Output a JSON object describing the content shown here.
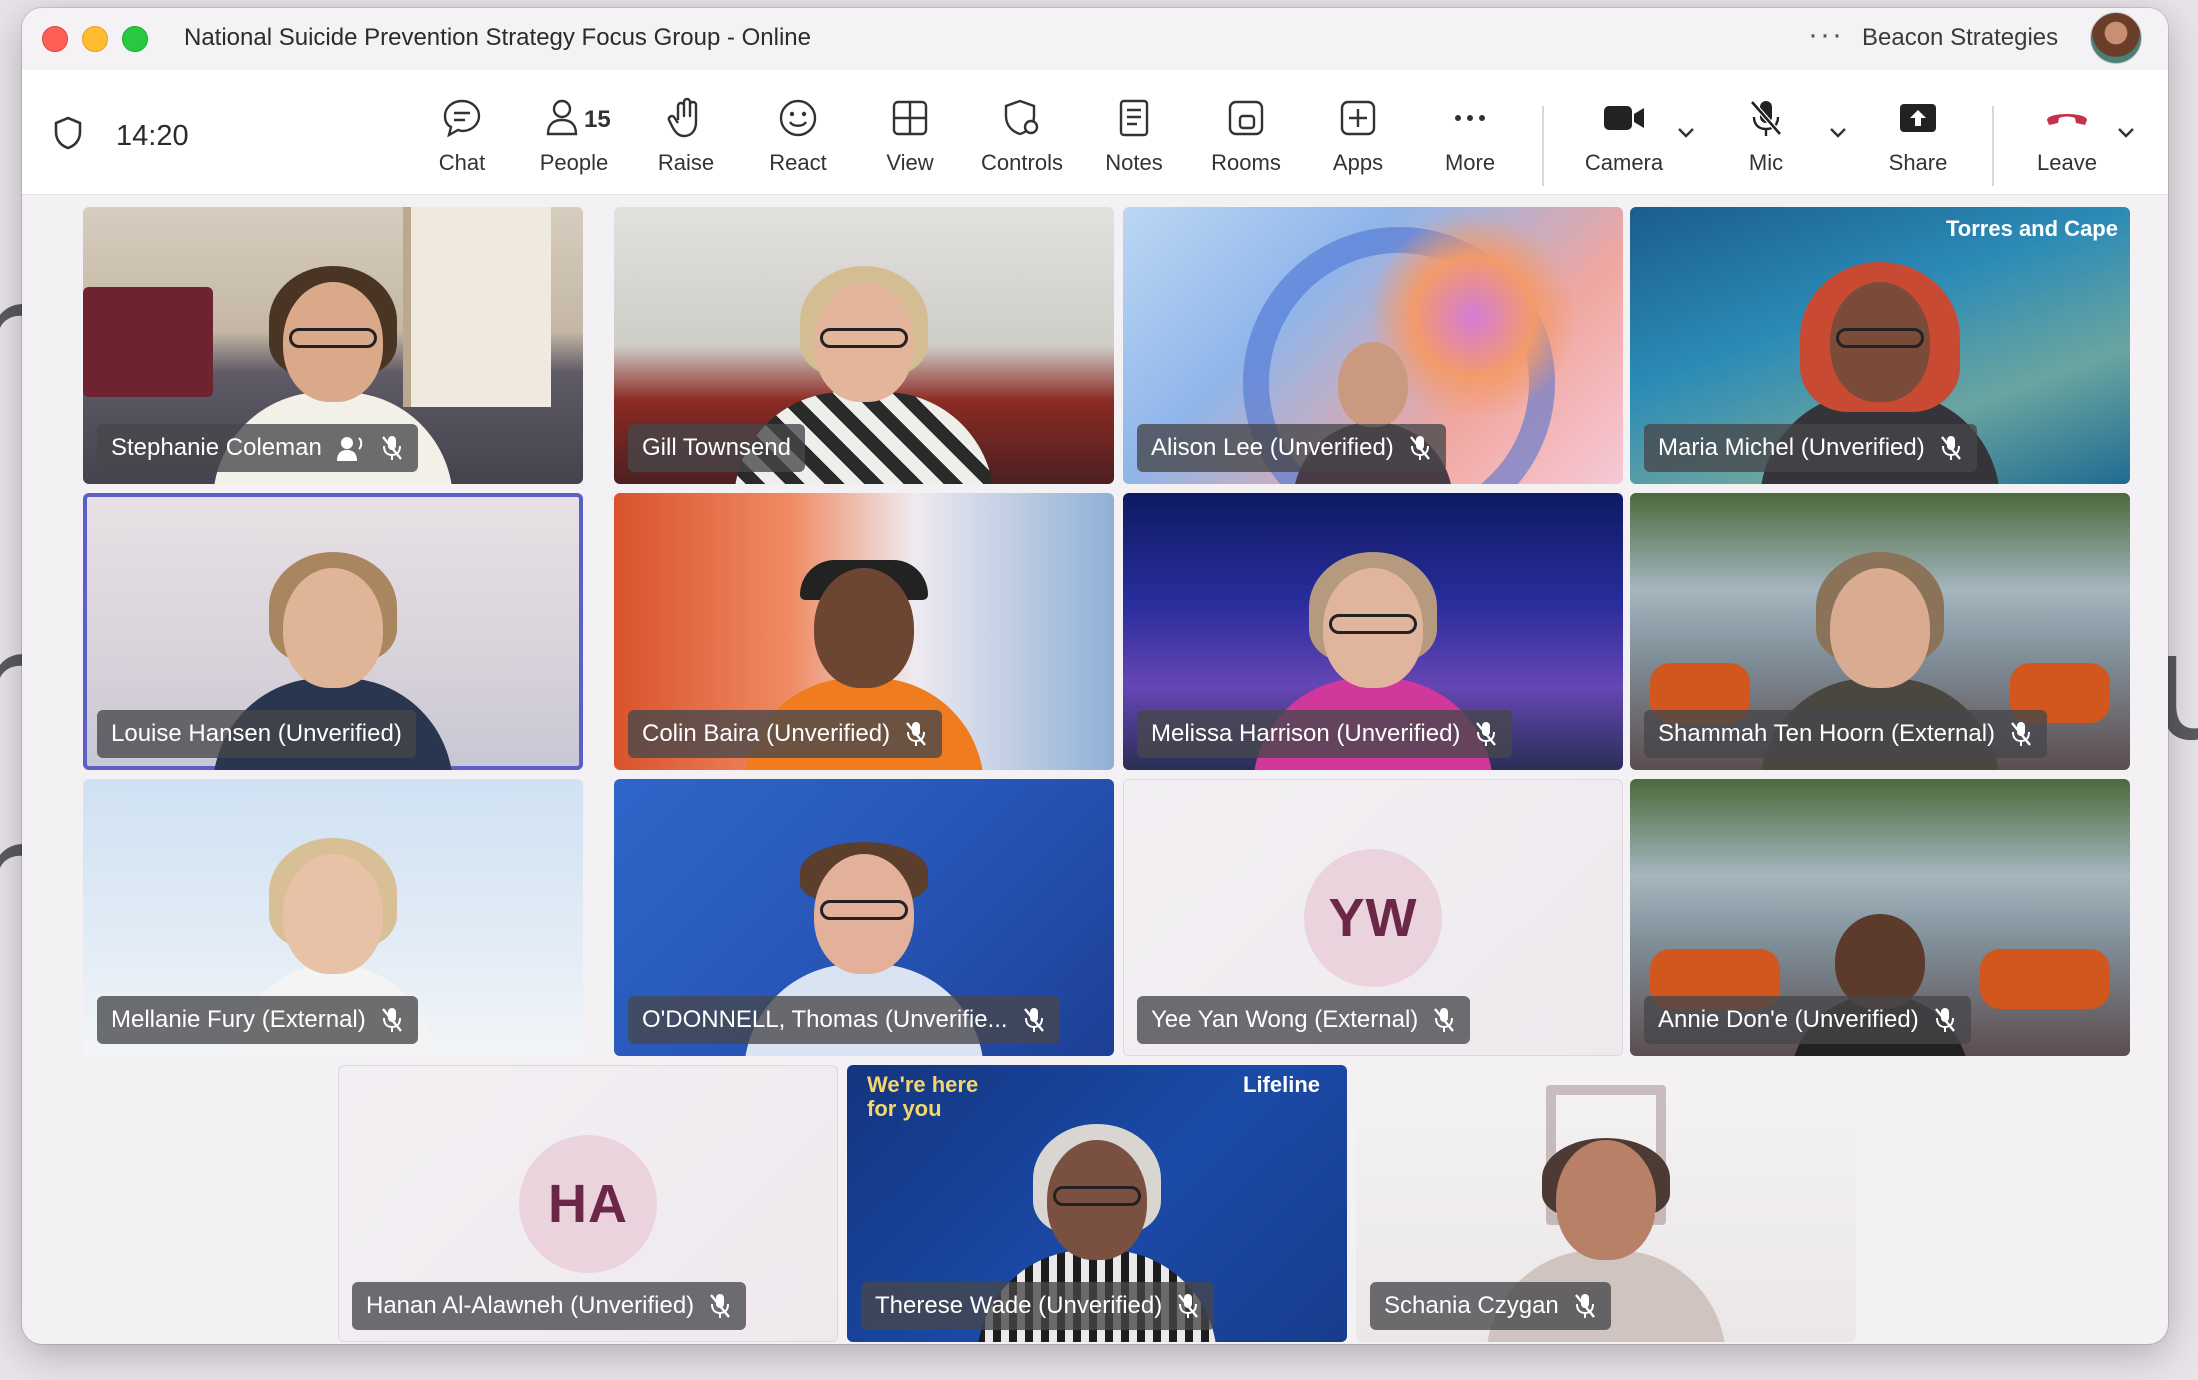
{
  "window": {
    "title": "National Suicide Prevention Strategy Focus Group - Online",
    "more_label": "···",
    "organization": "Beacon Strategies"
  },
  "toolbar": {
    "time": "14:20",
    "buttons": {
      "chat": "Chat",
      "people": "People",
      "people_count": "15",
      "raise": "Raise",
      "react": "React",
      "view": "View",
      "controls": "Controls",
      "notes": "Notes",
      "rooms": "Rooms",
      "apps": "Apps",
      "more": "More",
      "camera": "Camera",
      "mic": "Mic",
      "share": "Share",
      "leave": "Leave"
    }
  },
  "participants": [
    {
      "name": "Stephanie Coleman",
      "muted": true,
      "speaking_icon": true
    },
    {
      "name": "Gill Townsend",
      "muted": false
    },
    {
      "name": "Alison Lee (Unverified)",
      "muted": true
    },
    {
      "name": "Maria Michel (Unverified)",
      "muted": true,
      "background_text": "Torres and Cape"
    },
    {
      "name": "Louise Hansen (Unverified)",
      "muted": false,
      "active": true
    },
    {
      "name": "Colin Baira (Unverified)",
      "muted": true
    },
    {
      "name": "Melissa Harrison (Unverified)",
      "muted": true
    },
    {
      "name": "Shammah Ten Hoorn (External)",
      "muted": true
    },
    {
      "name": "Mellanie Fury (External)",
      "muted": true
    },
    {
      "name": "O'DONNELL, Thomas (Unverifie...",
      "muted": true
    },
    {
      "name": "Yee Yan Wong (External)",
      "muted": true,
      "initials": "YW"
    },
    {
      "name": "Annie Don'e (Unverified)",
      "muted": true
    },
    {
      "name": "Hanan Al-Alawneh (Unverified)",
      "muted": true,
      "initials": "HA"
    },
    {
      "name": "Therese Wade (Unverified)",
      "muted": true,
      "background_text": "We're here for you",
      "logo_text": "Lifeline"
    },
    {
      "name": "Schania Czygan",
      "muted": true
    }
  ],
  "colors": {
    "accent": "#5b5fc7",
    "leave_red": "#c4314b",
    "initials_bg": "#ebd3dd",
    "initials_fg": "#6b2747"
  }
}
